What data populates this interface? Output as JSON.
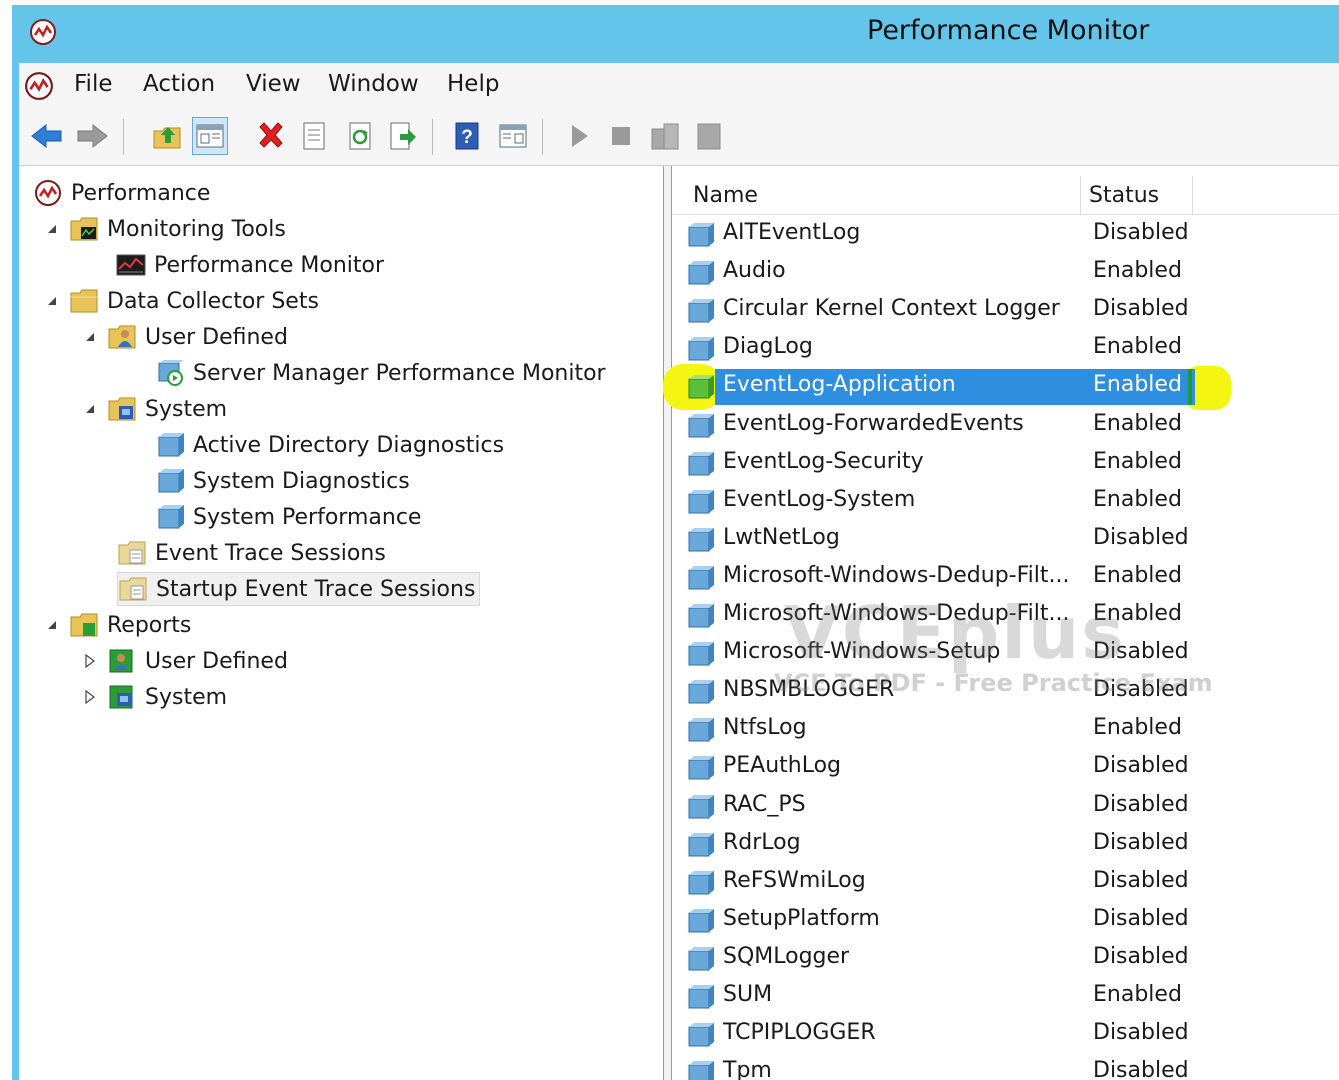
{
  "window": {
    "title": "Performance Monitor"
  },
  "menu": {
    "items": [
      "File",
      "Action",
      "View",
      "Window",
      "Help"
    ]
  },
  "toolbar": {
    "buttons": [
      "back-icon",
      "forward-icon",
      "up-folder-icon",
      "show-hide-console-tree-icon",
      "delete-icon",
      "properties-icon",
      "refresh-icon",
      "export-list-icon",
      "help-icon",
      "show-hide-action-pane-icon",
      "start-icon",
      "stop-icon",
      "data-manager-icon",
      "latest-report-icon"
    ]
  },
  "tree": {
    "nodes": [
      {
        "label": "Performance",
        "icon": "perfmon-icon"
      },
      {
        "label": "Monitoring Tools",
        "icon": "monitoring-tools-icon"
      },
      {
        "label": "Performance Monitor",
        "icon": "performance-monitor-chart-icon"
      },
      {
        "label": "Data Collector Sets",
        "icon": "folder-icon"
      },
      {
        "label": "User Defined",
        "icon": "user-folder-icon"
      },
      {
        "label": "Server Manager Performance Monitor",
        "icon": "data-collector-set-icon"
      },
      {
        "label": "System",
        "icon": "system-folder-icon"
      },
      {
        "label": "Active Directory Diagnostics",
        "icon": "data-collector-set-icon"
      },
      {
        "label": "System Diagnostics",
        "icon": "data-collector-set-icon"
      },
      {
        "label": "System Performance",
        "icon": "data-collector-set-icon"
      },
      {
        "label": "Event Trace Sessions",
        "icon": "trace-folder-icon"
      },
      {
        "label": "Startup Event Trace Sessions",
        "icon": "trace-folder-icon"
      },
      {
        "label": "Reports",
        "icon": "reports-folder-icon"
      },
      {
        "label": "User Defined",
        "icon": "user-reports-icon"
      },
      {
        "label": "System",
        "icon": "system-reports-icon"
      }
    ]
  },
  "list": {
    "columns": [
      "Name",
      "Status"
    ],
    "rows": [
      {
        "name": "AITEventLog",
        "status": "Disabled"
      },
      {
        "name": "Audio",
        "status": "Enabled"
      },
      {
        "name": "Circular Kernel Context Logger",
        "status": "Disabled"
      },
      {
        "name": "DiagLog",
        "status": "Enabled"
      },
      {
        "name": "EventLog-Application",
        "status": "Enabled"
      },
      {
        "name": "EventLog-ForwardedEvents",
        "status": "Enabled"
      },
      {
        "name": "EventLog-Security",
        "status": "Enabled"
      },
      {
        "name": "EventLog-System",
        "status": "Enabled"
      },
      {
        "name": "LwtNetLog",
        "status": "Disabled"
      },
      {
        "name": "Microsoft-Windows-Dedup-Filt...",
        "status": "Enabled"
      },
      {
        "name": "Microsoft-Windows-Dedup-Filt...",
        "status": "Enabled"
      },
      {
        "name": "Microsoft-Windows-Setup",
        "status": "Disabled"
      },
      {
        "name": "NBSMBLOGGER",
        "status": "Disabled"
      },
      {
        "name": "NtfsLog",
        "status": "Enabled"
      },
      {
        "name": "PEAuthLog",
        "status": "Disabled"
      },
      {
        "name": "RAC_PS",
        "status": "Disabled"
      },
      {
        "name": "RdrLog",
        "status": "Disabled"
      },
      {
        "name": "ReFSWmiLog",
        "status": "Disabled"
      },
      {
        "name": "SetupPlatform",
        "status": "Disabled"
      },
      {
        "name": "SQMLogger",
        "status": "Disabled"
      },
      {
        "name": "SUM",
        "status": "Enabled"
      },
      {
        "name": "TCPIPLOGGER",
        "status": "Disabled"
      },
      {
        "name": "Tpm",
        "status": "Disabled"
      }
    ]
  },
  "watermark": {
    "main": "VCEplus",
    "sub": "VCE To PDF - Free Practice Exam"
  },
  "colors": {
    "titlebar": "#63c5ea",
    "selection": "#2e8ee0",
    "highlight": "#f5f512"
  }
}
